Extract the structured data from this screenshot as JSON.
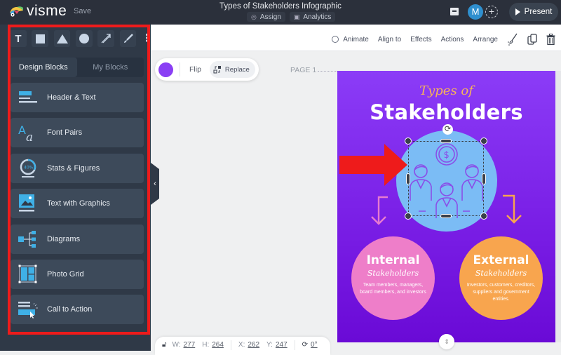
{
  "app": {
    "brand": "visme",
    "save_label": "Save",
    "doc_title": "Types of Stakeholders Infographic",
    "doc_actions": [
      {
        "label": "Assign",
        "icon": "assign-icon"
      },
      {
        "label": "Analytics",
        "icon": "analytics-icon"
      }
    ],
    "avatar_initial": "M",
    "add_collaborator": "+",
    "present_label": "Present"
  },
  "sidebar": {
    "tools": [
      {
        "name": "text-tool",
        "glyph": "T"
      },
      {
        "name": "rectangle-tool"
      },
      {
        "name": "triangle-tool"
      },
      {
        "name": "circle-tool"
      },
      {
        "name": "line-tool"
      },
      {
        "name": "brush-tool"
      }
    ],
    "more_glyph": "⋮",
    "tabs": [
      {
        "label": "Design Blocks",
        "active": true
      },
      {
        "label": "My Blocks",
        "active": false
      }
    ],
    "blocks": [
      {
        "label": "Header & Text",
        "icon": "header-text-icon"
      },
      {
        "label": "Font Pairs",
        "icon": "font-pairs-icon"
      },
      {
        "label": "Stats & Figures",
        "icon": "stats-figures-icon",
        "icon_text": "40%"
      },
      {
        "label": "Text with Graphics",
        "icon": "text-graphics-icon"
      },
      {
        "label": "Diagrams",
        "icon": "diagrams-icon"
      },
      {
        "label": "Photo Grid",
        "icon": "photo-grid-icon"
      },
      {
        "label": "Call to Action",
        "icon": "call-to-action-icon"
      }
    ],
    "collapse_glyph": "‹"
  },
  "actionbar": {
    "items": [
      "Animate",
      "Align to",
      "Effects",
      "Actions",
      "Arrange"
    ]
  },
  "floatbar": {
    "color": "#8a3ff4",
    "flip_label": "Flip",
    "replace_label": "Replace"
  },
  "page_label": "PAGE 1",
  "poster": {
    "types_of": "Types of",
    "title": "Stakeholders",
    "internal": {
      "title": "Internal",
      "subtitle": "Stakeholders",
      "desc": "Team members, managers, board members, and investors"
    },
    "external": {
      "title": "External",
      "subtitle": "Stakeholders",
      "desc": "Investors, customers, creditors, suppliers and government entities."
    }
  },
  "bottombar": {
    "w_label": "W:",
    "w": "277",
    "h_label": "H:",
    "h": "264",
    "x_label": "X:",
    "x": "262",
    "y_label": "Y:",
    "y": "247",
    "rotation": "0°"
  },
  "colors": {
    "highlight": "#ee1b1b",
    "poster_bg": "#7a1fe6",
    "center_circle": "#7bbcf5",
    "internal": "#ee7ec9",
    "external": "#f8a54e",
    "accent": "#2f8fce"
  }
}
